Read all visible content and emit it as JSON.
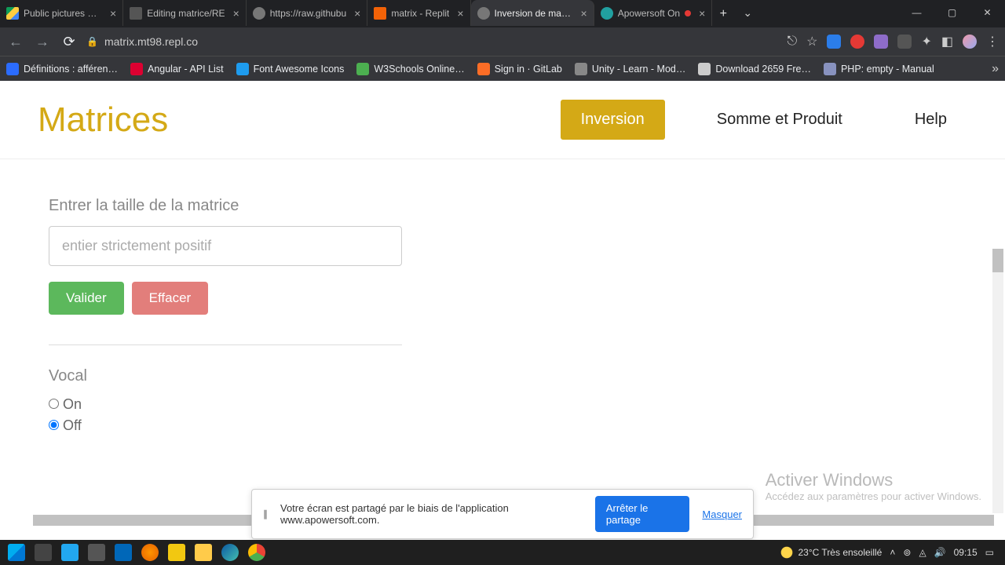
{
  "tabs": [
    {
      "title": "Public pictures doc",
      "favColor": "#0f9d58"
    },
    {
      "title": "Editing matrice/RE",
      "favColor": "#555"
    },
    {
      "title": "https://raw.githubu",
      "favColor": "#777"
    },
    {
      "title": "matrix - Replit",
      "favColor": "#f26207"
    },
    {
      "title": "Inversion de matric",
      "favColor": "#777",
      "active": true
    },
    {
      "title": "Apowersoft On",
      "favColor": "#21a0a0",
      "rec": true
    }
  ],
  "url": "matrix.mt98.repl.co",
  "bookmarks": [
    {
      "label": "Définitions : afféren…",
      "color": "#2b6cff"
    },
    {
      "label": "Angular - API List",
      "color": "#dd0031"
    },
    {
      "label": "Font Awesome Icons",
      "color": "#1e9cef"
    },
    {
      "label": "W3Schools Online…",
      "color": "#4caf50"
    },
    {
      "label": "Sign in · GitLab",
      "color": "#fc6d26"
    },
    {
      "label": "Unity - Learn - Mod…",
      "color": "#888"
    },
    {
      "label": "Download 2659 Fre…",
      "color": "#ccc"
    },
    {
      "label": "PHP: empty - Manual",
      "color": "#8892bf"
    }
  ],
  "page": {
    "brand": "Matrices",
    "nav": {
      "inversion": "Inversion",
      "somme": "Somme et Produit",
      "help": "Help"
    },
    "size_label": "Entrer la taille de la matrice",
    "size_placeholder": "entier strictement positif",
    "btn_valider": "Valider",
    "btn_effacer": "Effacer",
    "vocal_title": "Vocal",
    "vocal_on": "On",
    "vocal_off": "Off"
  },
  "watermark": {
    "line1": "Activer Windows",
    "line2": "Accédez aux paramètres pour activer Windows."
  },
  "share": {
    "msg": "Votre écran est partagé par le biais de l'application www.apowersoft.com.",
    "stop": "Arrêter le partage",
    "hide": "Masquer"
  },
  "tray": {
    "weather": "23°C  Très ensoleillé",
    "time": "09:15"
  }
}
